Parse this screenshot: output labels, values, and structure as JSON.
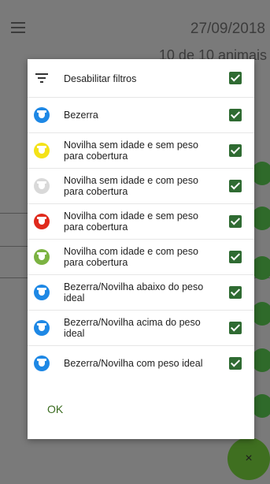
{
  "background": {
    "date": "27/09/2018",
    "animal_count": "10 de 10 animais"
  },
  "dialog": {
    "disable_filters_label": "Desabilitar filtros",
    "items": [
      {
        "label": "Bezerra",
        "icon": "cow-icon",
        "color": "#1e88e5",
        "checked": true
      },
      {
        "label": "Novilha sem idade e sem peso para cobertura",
        "icon": "cow-icon",
        "color": "#f4e218",
        "checked": true
      },
      {
        "label": "Novilha sem idade e com peso para cobertura",
        "icon": "cow-icon",
        "color": "#d9d9d9",
        "checked": true
      },
      {
        "label": "Novilha com idade e sem peso para cobertura",
        "icon": "cow-icon",
        "color": "#e02a1c",
        "checked": true
      },
      {
        "label": "Novilha com idade e com peso para cobertura",
        "icon": "cow-icon",
        "color": "#7cb342",
        "checked": true
      },
      {
        "label": "Bezerra/Novilha abaixo do peso ideal",
        "icon": "cow-icon",
        "color": "#1e88e5",
        "checked": true
      },
      {
        "label": "Bezerra/Novilha acima do peso ideal",
        "icon": "cow-icon",
        "color": "#1e88e5",
        "checked": true
      },
      {
        "label": "Bezerra/Novilha com peso ideal",
        "icon": "cow-icon",
        "color": "#1e88e5",
        "checked": true
      }
    ],
    "ok_label": "OK"
  },
  "fab": {
    "icon": "close-icon",
    "glyph": "×"
  }
}
